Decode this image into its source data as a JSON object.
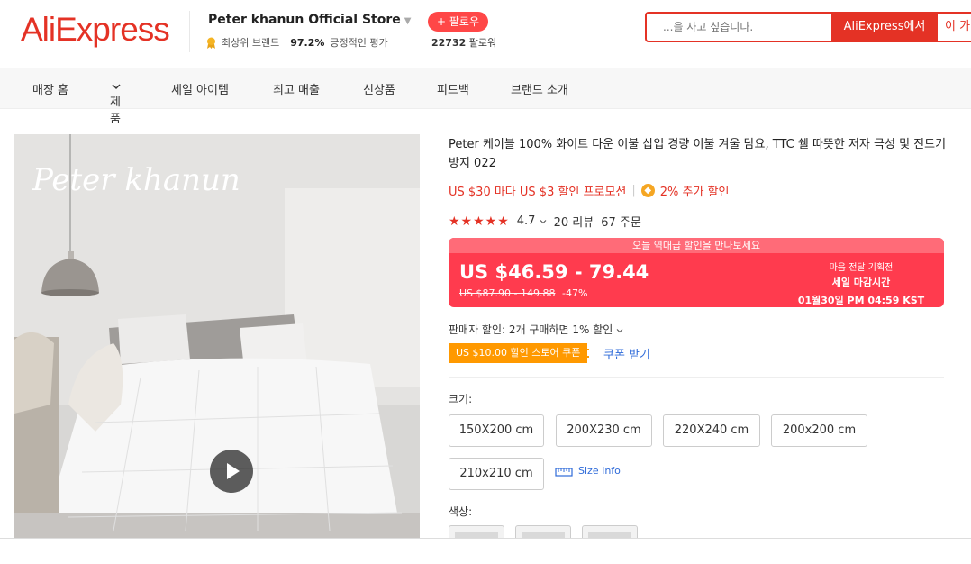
{
  "header": {
    "logo": "AliExpress",
    "store_name": "Peter khanun Official Store",
    "store_badge": "최상위 브랜드",
    "store_rating": "97.2%",
    "store_rating_label": "긍정적인 평가",
    "follow_label": "+ 팔로우",
    "followers_count": "22732",
    "followers_label": "팔로워",
    "search_placeholder": "...을 사고 싶습니다.",
    "search_button": "AliExpress에서",
    "search_button2": "이 가"
  },
  "nav": [
    "매장 홈",
    "제품",
    "세일 아이템",
    "최고 매출",
    "신상품",
    "피드백",
    "브랜드 소개"
  ],
  "media": {
    "brand_script": "Peter khanun"
  },
  "product": {
    "title": "Peter 케이블 100% 화이트 다운 이불 삽입 경량 이불 겨울 담요, TTC 쉘 따뜻한 저자 극성 및 진드기 방지 022",
    "promo": "US $30 마다 US $3 할인 프로모션",
    "promo_extra": "2% 추가 할인",
    "rating": "4.7",
    "reviews": "20 리뷰",
    "orders": "67 주문"
  },
  "deal": {
    "banner": "오늘 역대급 할인을 만나보세요",
    "price": "US $46.59 - 79.44",
    "original_price": "US $87.90 - 149.88",
    "discount": "-47%",
    "right_line1": "마음 전달 기획전",
    "right_line2": "세일 마감시간",
    "right_line3": "01월30일 PM 04:59 KST"
  },
  "discounts": {
    "seller": "판매자 할인: 2개 구매하면 1% 할인",
    "coupon": "US $10.00 할인 스토어 쿠폰",
    "coupon_link": "쿠폰 받기"
  },
  "sizes": {
    "label": "크기:",
    "options": [
      "150X200 cm",
      "200X230 cm",
      "220X240 cm",
      "200x200 cm",
      "210x210 cm"
    ],
    "size_info": "Size Info"
  },
  "colors": {
    "label": "색상:"
  },
  "palette": {
    "brand_red": "#e43225",
    "deal_red": "#ff3b4e",
    "coupon_orange": "#ff9900",
    "link_blue": "#2f6bd9"
  }
}
